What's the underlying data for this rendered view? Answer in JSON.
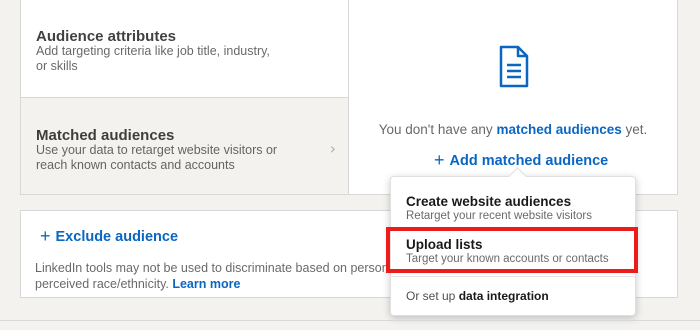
{
  "targeting": {
    "audience_attributes": {
      "title": "Audience attributes",
      "description": "Add targeting criteria like job title, industry, or skills"
    },
    "matched_audiences": {
      "title": "Matched audiences",
      "description": "Use your data to retarget website visitors or reach known contacts and accounts",
      "chevron": "›"
    }
  },
  "empty_state": {
    "icon": "document-icon",
    "text_prefix": "You don't have any ",
    "text_link": "matched audiences",
    "text_suffix": " yet.",
    "add_plus": "+",
    "add_label": "Add matched audience"
  },
  "exclude": {
    "plus": "+",
    "label": "Exclude audience",
    "disclaimer_line1": "LinkedIn tools may not be used to discriminate based on personal c",
    "disclaimer_line2": "perceived race/ethnicity. ",
    "learn_more": "Learn more"
  },
  "dropdown": {
    "options": [
      {
        "title": "Create website audiences",
        "description": "Retarget your recent website visitors"
      },
      {
        "title": "Upload lists",
        "description": "Target your known accounts or contacts"
      }
    ],
    "integration_prefix": "Or set up ",
    "integration_link": "data integration"
  },
  "colors": {
    "accent": "#0a66c2",
    "highlight": "#ec1c1c",
    "panel_border": "#d8d8d8",
    "background": "#f3f2ef"
  }
}
